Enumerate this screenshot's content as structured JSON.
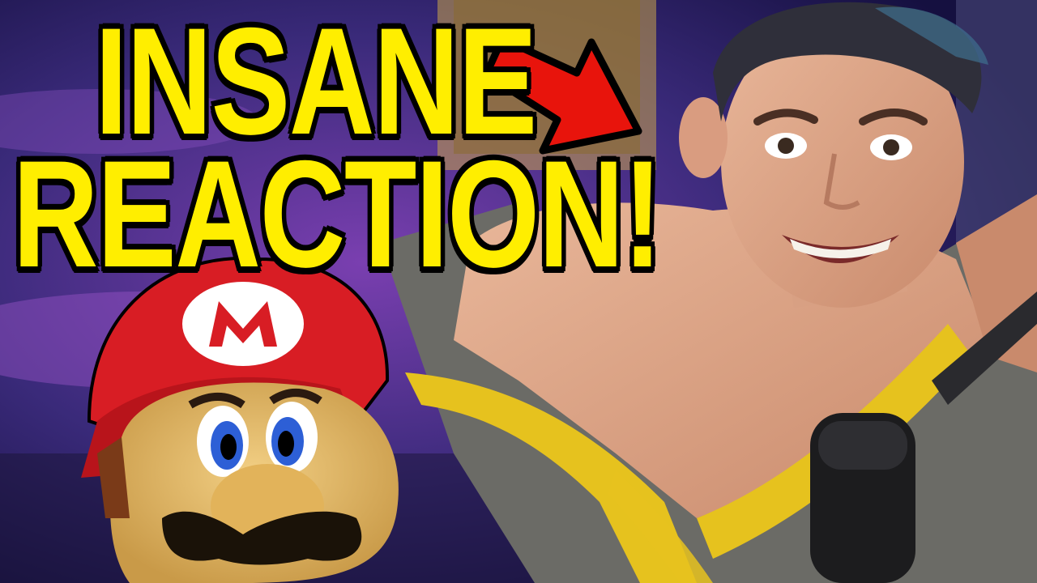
{
  "thumbnail": {
    "headline_line1": "INSANE",
    "headline_line2": "REACTION!",
    "colors": {
      "headline_fill": "#ffee00",
      "headline_outline": "#000000",
      "arrow": "#e8140c",
      "background": "#2a2060"
    },
    "icons": {
      "arrow": "red-arrow-icon",
      "mario": "mario-head-illustration"
    }
  }
}
